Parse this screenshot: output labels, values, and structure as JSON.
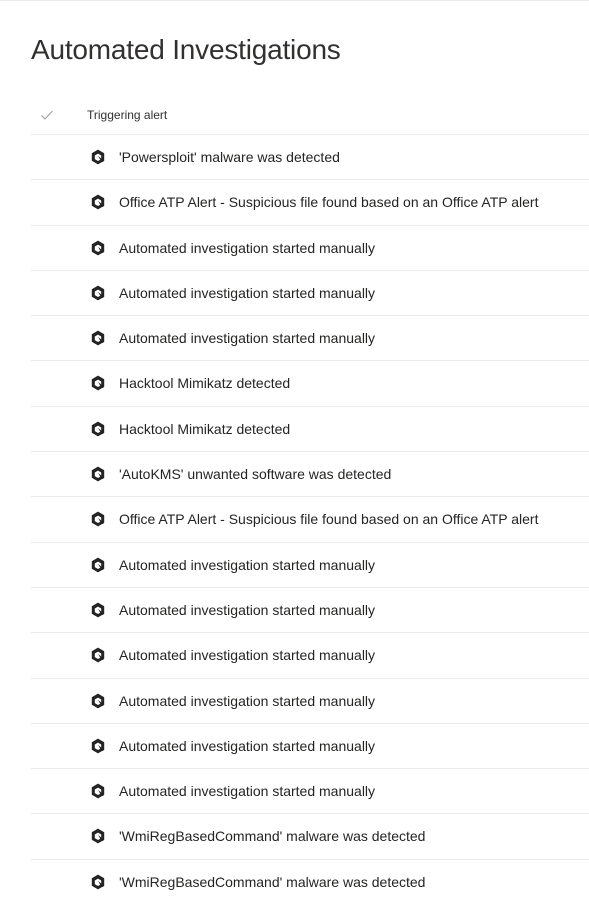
{
  "page": {
    "title": "Automated Investigations"
  },
  "table": {
    "header": {
      "select_all_icon": "checkmark-icon",
      "column_label": "Triggering alert"
    },
    "row_icon": "defender-alert-icon",
    "rows": [
      {
        "alert": "'Powersploit' malware was detected"
      },
      {
        "alert": "Office ATP Alert - Suspicious file found based on an Office ATP alert"
      },
      {
        "alert": "Automated investigation started manually"
      },
      {
        "alert": "Automated investigation started manually"
      },
      {
        "alert": "Automated investigation started manually"
      },
      {
        "alert": "Hacktool Mimikatz detected"
      },
      {
        "alert": "Hacktool Mimikatz detected"
      },
      {
        "alert": "'AutoKMS' unwanted software was detected"
      },
      {
        "alert": "Office ATP Alert - Suspicious file found based on an Office ATP alert"
      },
      {
        "alert": "Automated investigation started manually"
      },
      {
        "alert": "Automated investigation started manually"
      },
      {
        "alert": "Automated investigation started manually"
      },
      {
        "alert": "Automated investigation started manually"
      },
      {
        "alert": "Automated investigation started manually"
      },
      {
        "alert": "Automated investigation started manually"
      },
      {
        "alert": "'WmiRegBasedCommand' malware was detected"
      },
      {
        "alert": "'WmiRegBasedCommand' malware was detected"
      }
    ]
  },
  "colors": {
    "text": "#252423",
    "divider": "#edebe9",
    "checkmark": "#a19f9d",
    "icon": "#252423"
  }
}
